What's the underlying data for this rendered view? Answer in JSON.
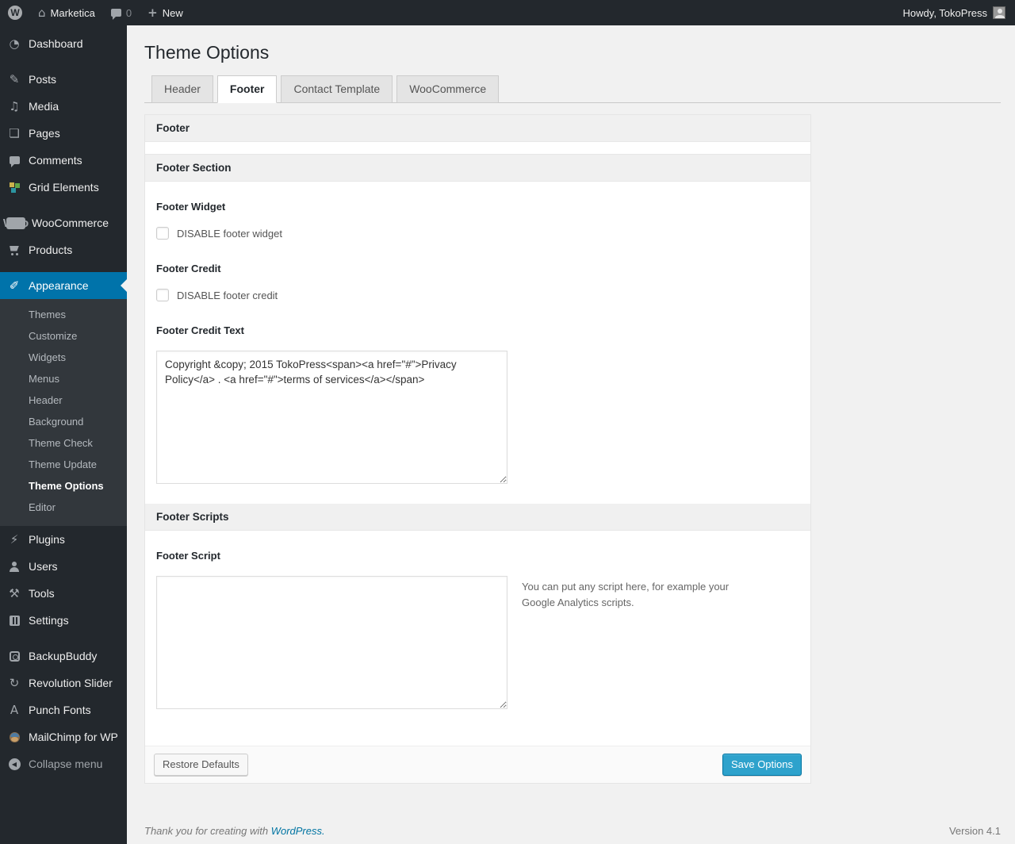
{
  "colors": {
    "admin_dark": "#23282d",
    "accent_blue": "#0073aa",
    "button_blue": "#2ea2cc",
    "link_blue": "#0074a2"
  },
  "icons": {
    "wp": "W",
    "home": "⌂",
    "plus": "+",
    "dashboard": "◔",
    "posts": "✎",
    "media": "♫",
    "pages": "❏",
    "appearance": "✐",
    "plugins": "⚡",
    "tools": "⚒",
    "revolution": "↻",
    "punch": "A",
    "collapse": "◀",
    "woo": "Woo"
  },
  "admin_bar": {
    "site_name": "Marketica",
    "comment_count": "0",
    "new_label": "New",
    "howdy": "Howdy, TokoPress"
  },
  "sidebar": {
    "items": [
      "Dashboard",
      "Posts",
      "Media",
      "Pages",
      "Comments",
      "Grid Elements",
      "WooCommerce",
      "Products",
      "Appearance",
      "Plugins",
      "Users",
      "Tools",
      "Settings",
      "BackupBuddy",
      "Revolution Slider",
      "Punch Fonts",
      "MailChimp for WP"
    ],
    "submenu": [
      "Themes",
      "Customize",
      "Widgets",
      "Menus",
      "Header",
      "Background",
      "Theme Check",
      "Theme Update",
      "Theme Options",
      "Editor"
    ],
    "collapse": "Collapse menu"
  },
  "main": {
    "title": "Theme Options",
    "tabs": [
      "Header",
      "Footer",
      "Contact Template",
      "WooCommerce"
    ],
    "active_tab": "Footer",
    "box_title": "Footer",
    "section_footer": "Footer Section",
    "footer_widget_label": "Footer Widget",
    "footer_widget_checkbox": "DISABLE footer widget",
    "footer_credit_label": "Footer Credit",
    "footer_credit_checkbox": "DISABLE footer credit",
    "footer_credit_text_label": "Footer Credit Text",
    "footer_credit_text_value": "Copyright &copy; 2015 TokoPress<span><a href=\"#\">Privacy Policy</a> . <a href=\"#\">terms of services</a></span>",
    "section_scripts": "Footer Scripts",
    "footer_script_label": "Footer Script",
    "footer_script_value": "",
    "footer_script_help": "You can put any script here, for example your Google Analytics scripts.",
    "restore_button": "Restore Defaults",
    "save_button": "Save Options"
  },
  "footer": {
    "thanks": "Thank you for creating with",
    "wordpress_link": "WordPress.",
    "version": "Version 4.1"
  }
}
